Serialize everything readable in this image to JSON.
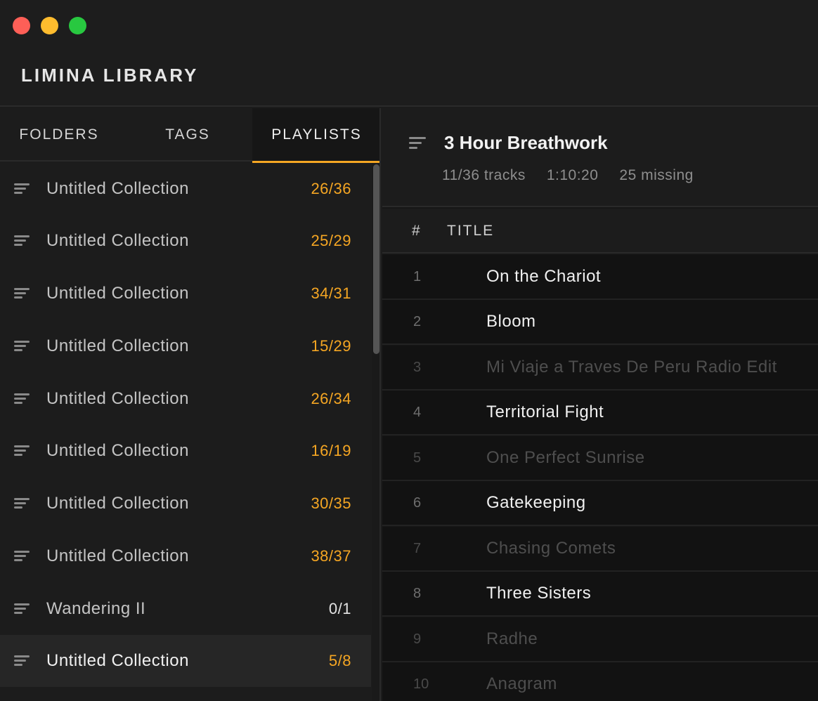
{
  "app": {
    "title": "LIMINA LIBRARY"
  },
  "tabs": [
    {
      "label": "FOLDERS",
      "active": false
    },
    {
      "label": "TAGS",
      "active": false
    },
    {
      "label": "PLAYLISTS",
      "active": true
    }
  ],
  "sidebar": {
    "items": [
      {
        "label": "Untitled Collection",
        "count": "26/36",
        "highlight": true,
        "selected": false
      },
      {
        "label": "Untitled Collection",
        "count": "25/29",
        "highlight": true,
        "selected": false
      },
      {
        "label": "Untitled Collection",
        "count": "34/31",
        "highlight": true,
        "selected": false
      },
      {
        "label": "Untitled Collection",
        "count": "15/29",
        "highlight": true,
        "selected": false
      },
      {
        "label": "Untitled Collection",
        "count": "26/34",
        "highlight": true,
        "selected": false
      },
      {
        "label": "Untitled Collection",
        "count": "16/19",
        "highlight": true,
        "selected": false
      },
      {
        "label": "Untitled Collection",
        "count": "30/35",
        "highlight": true,
        "selected": false
      },
      {
        "label": "Untitled Collection",
        "count": "38/37",
        "highlight": true,
        "selected": false
      },
      {
        "label": "Wandering II",
        "count": "0/1",
        "highlight": false,
        "selected": false
      },
      {
        "label": "Untitled Collection",
        "count": "5/8",
        "highlight": true,
        "selected": true
      }
    ]
  },
  "playlist": {
    "title": "3 Hour Breathwork",
    "tracks_summary": "11/36 tracks",
    "duration": "1:10:20",
    "missing": "25 missing"
  },
  "columns": {
    "number": "#",
    "title": "TITLE"
  },
  "tracks": [
    {
      "num": "1",
      "title": "On the Chariot",
      "missing": false
    },
    {
      "num": "2",
      "title": "Bloom",
      "missing": false
    },
    {
      "num": "3",
      "title": "Mi Viaje a Traves De Peru Radio Edit",
      "missing": true
    },
    {
      "num": "4",
      "title": "Territorial Fight",
      "missing": false
    },
    {
      "num": "5",
      "title": "One Perfect Sunrise",
      "missing": true
    },
    {
      "num": "6",
      "title": "Gatekeeping",
      "missing": false
    },
    {
      "num": "7",
      "title": "Chasing Comets",
      "missing": true
    },
    {
      "num": "8",
      "title": "Three Sisters",
      "missing": false
    },
    {
      "num": "9",
      "title": "Radhe",
      "missing": true
    },
    {
      "num": "10",
      "title": "Anagram",
      "missing": true
    }
  ],
  "colors": {
    "accent": "#f5a623",
    "close": "#fe5f57",
    "minimize": "#febc2e",
    "maximize": "#28c840"
  },
  "icons": {
    "playlist": "list-lines-icon",
    "close": "close-window-icon",
    "minimize": "minimize-window-icon",
    "maximize": "maximize-window-icon"
  }
}
